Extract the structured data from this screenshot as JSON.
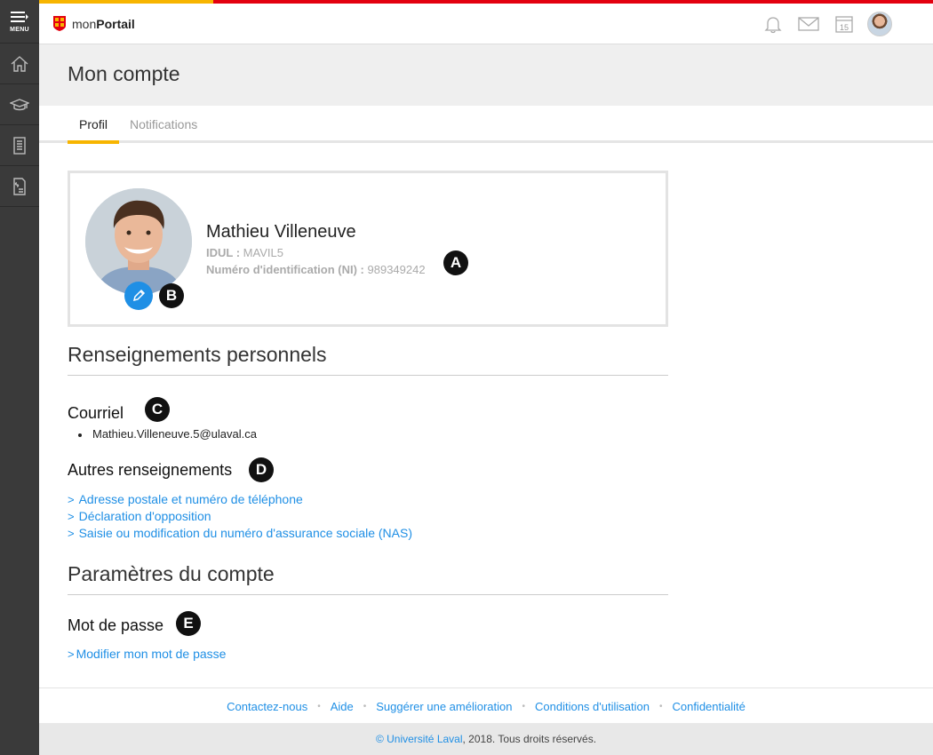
{
  "rail": {
    "menu_label": "MENU"
  },
  "header": {
    "brand_prefix": "mon",
    "brand_bold": "Portail",
    "calendar_day": "15"
  },
  "page": {
    "title": "Mon compte"
  },
  "tabs": [
    {
      "label": "Profil",
      "active": true
    },
    {
      "label": "Notifications",
      "active": false
    }
  ],
  "profile": {
    "name": "Mathieu Villeneuve",
    "idul_label": "IDUL :",
    "idul_value": "MAVIL5",
    "ni_label": "Numéro d'identification (NI) :",
    "ni_value": "989349242"
  },
  "callouts": {
    "a": "A",
    "b": "B",
    "c": "C",
    "d": "D",
    "e": "E"
  },
  "sections": {
    "personal_title": "Renseignements personnels",
    "email_title": "Courriel",
    "email_value": "Mathieu.Villeneuve.5@ulaval.ca",
    "other_title": "Autres renseignements",
    "other_links": [
      "Adresse postale et numéro de téléphone",
      "Déclaration d'opposition",
      "Saisie ou modification du numéro d'assurance sociale (NAS)"
    ],
    "account_title": "Paramètres du compte",
    "password_title": "Mot de passe",
    "password_link": "Modifier mon mot de passe"
  },
  "footer": {
    "links": [
      "Contactez-nous",
      "Aide",
      "Suggérer une amélioration",
      "Conditions d'utilisation",
      "Confidentialité"
    ],
    "separator": "•",
    "copyright_link": "© Université Laval",
    "copyright_rest": ", 2018. Tous droits réservés."
  },
  "colors": {
    "accent_yellow": "#f7b500",
    "accent_red": "#e3000f",
    "link_blue": "#1f8fe5",
    "rail": "#3a3a3a"
  },
  "icons": [
    "menu-icon",
    "home-icon",
    "graduation-cap-icon",
    "document-icon",
    "invoice-icon",
    "bell-icon",
    "mail-icon",
    "calendar-icon",
    "pencil-icon",
    "chevron-right-icon"
  ]
}
